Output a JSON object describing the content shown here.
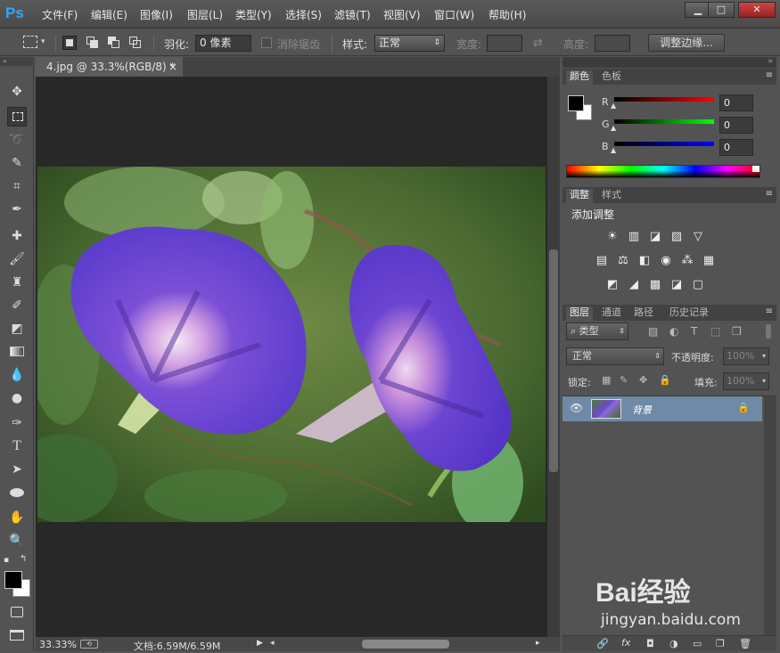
{
  "app": {
    "logo": "Ps"
  },
  "menu": [
    "文件(F)",
    "编辑(E)",
    "图像(I)",
    "图层(L)",
    "类型(Y)",
    "选择(S)",
    "滤镜(T)",
    "视图(V)",
    "窗口(W)",
    "帮助(H)"
  ],
  "window_buttons": {
    "minimize": "▁",
    "maximize": "□",
    "close": "✕"
  },
  "options": {
    "feather_label": "羽化:",
    "feather_value": "0 像素",
    "antialias_label": "消除锯齿",
    "style_label": "样式:",
    "style_value": "正常",
    "width_label": "宽度:",
    "height_label": "高度:",
    "refine_edge": "调整边缘..."
  },
  "document": {
    "tab_title": "4.jpg @ 33.3%(RGB/8) *",
    "tab_close": "×",
    "zoom": "33.33%",
    "doc_info": "文档:6.59M/6.59M"
  },
  "color_panel": {
    "tabs": [
      "颜色",
      "色板"
    ],
    "channels": [
      {
        "label": "R",
        "value": "0",
        "color": "#e02020"
      },
      {
        "label": "G",
        "value": "0",
        "color": "#20c020"
      },
      {
        "label": "B",
        "value": "0",
        "color": "#2020e0"
      }
    ]
  },
  "adjust_panel": {
    "tabs": [
      "调整",
      "样式"
    ],
    "title": "添加调整",
    "icons_row1": [
      "☀",
      "▥",
      "◪",
      "▨",
      "▽"
    ],
    "icons_row2": [
      "▤",
      "⚖",
      "◧",
      "◉",
      "⁂",
      "▦"
    ],
    "icons_row3": [
      "◩",
      "◢",
      "▩",
      "◪",
      "▢"
    ]
  },
  "layers_panel": {
    "tabs": [
      "图层",
      "通道",
      "路径",
      "历史记录"
    ],
    "filter_label": "类型",
    "blend_mode": "正常",
    "opacity_label": "不透明度:",
    "opacity_value": "100%",
    "lock_label": "锁定:",
    "fill_label": "填充:",
    "fill_value": "100%",
    "layers": [
      {
        "name": "背景",
        "visible": true,
        "locked": true
      }
    ]
  },
  "watermark": {
    "text": "Bai经验",
    "url": "jingyan.baidu.com"
  }
}
